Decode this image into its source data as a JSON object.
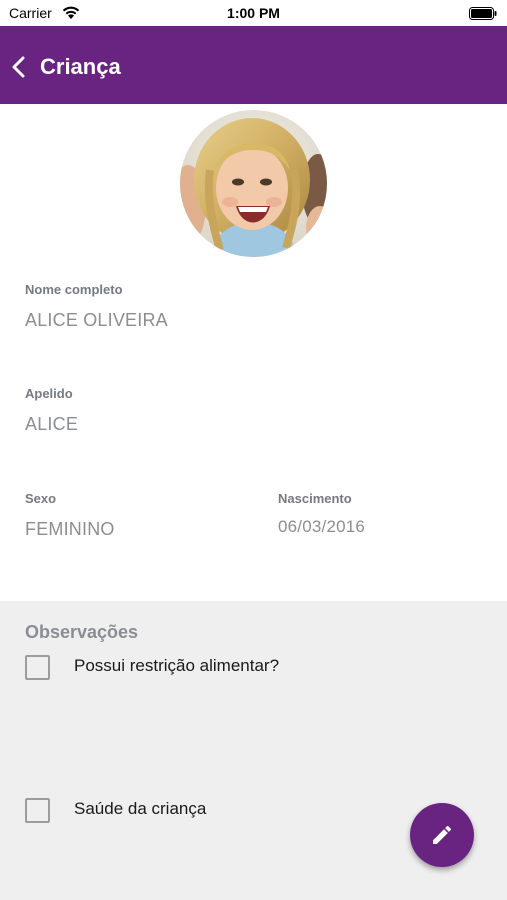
{
  "status_bar": {
    "carrier": "Carrier",
    "time": "1:00 PM"
  },
  "app_bar": {
    "title": "Criança",
    "color": "#692481"
  },
  "profile": {
    "full_name_label": "Nome completo",
    "full_name": "ALICE OLIVEIRA",
    "nickname_label": "Apelido",
    "nickname": "ALICE",
    "sex_label": "Sexo",
    "sex": "FEMININO",
    "birth_label": "Nascimento",
    "birth_date": "06/03/2016"
  },
  "observations": {
    "title": "Observações",
    "items": [
      {
        "label": "Possui restrição alimentar?",
        "checked": false
      },
      {
        "label": "Saúde da criança",
        "checked": false
      }
    ]
  },
  "fab": {
    "icon": "pencil-icon"
  }
}
